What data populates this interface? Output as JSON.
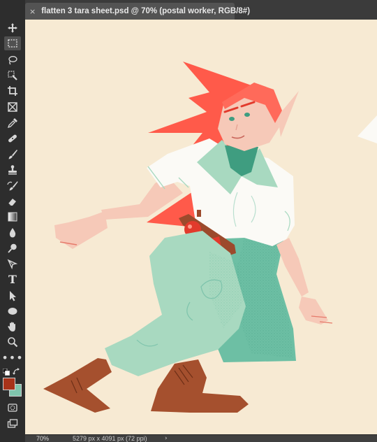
{
  "document_tab": {
    "close_symbol": "×",
    "title": "flatten 3 tara sheet.psd @ 70% (postal worker, RGB/8#)"
  },
  "tools": [
    {
      "name": "move-tool",
      "icon": "move-icon"
    },
    {
      "name": "marquee-tool",
      "icon": "rect-marquee-icon",
      "active": true
    },
    {
      "name": "lasso-tool",
      "icon": "lasso-icon"
    },
    {
      "name": "quick-select-tool",
      "icon": "quick-select-icon"
    },
    {
      "name": "crop-tool",
      "icon": "crop-icon"
    },
    {
      "name": "frame-tool",
      "icon": "frame-icon"
    },
    {
      "name": "eyedropper-tool",
      "icon": "eyedropper-icon"
    },
    {
      "name": "healing-brush-tool",
      "icon": "bandage-icon"
    },
    {
      "name": "brush-tool",
      "icon": "brush-icon"
    },
    {
      "name": "clone-stamp-tool",
      "icon": "stamp-icon"
    },
    {
      "name": "history-brush-tool",
      "icon": "history-brush-icon"
    },
    {
      "name": "eraser-tool",
      "icon": "eraser-icon"
    },
    {
      "name": "gradient-tool",
      "icon": "gradient-icon"
    },
    {
      "name": "blur-tool",
      "icon": "droplet-icon"
    },
    {
      "name": "dodge-tool",
      "icon": "dodge-icon"
    },
    {
      "name": "pen-tool",
      "icon": "pen-icon"
    },
    {
      "name": "type-tool",
      "icon": "type-icon",
      "glyph": "T"
    },
    {
      "name": "path-select-tool",
      "icon": "arrow-select-icon"
    },
    {
      "name": "shape-tool",
      "icon": "ellipse-icon"
    },
    {
      "name": "hand-tool",
      "icon": "hand-icon"
    },
    {
      "name": "zoom-tool",
      "icon": "magnifier-icon"
    },
    {
      "name": "edit-toolbar",
      "icon": "more-icon",
      "glyph": "•••"
    }
  ],
  "colors": {
    "foreground": "#a8331a",
    "background": "#7fc4ac",
    "canvas": "#f7ead3",
    "hair": "#ff5a4a",
    "shirt": "#fbfaf6",
    "pants": "#a8d9c0",
    "coat": "#6dbfa4",
    "boots": "#a5502e",
    "skin": "#f6c9b8"
  },
  "status": {
    "zoom": "70%",
    "doc_info": "5279 px x 4091 px (72 ppi)",
    "arrow": "›"
  }
}
